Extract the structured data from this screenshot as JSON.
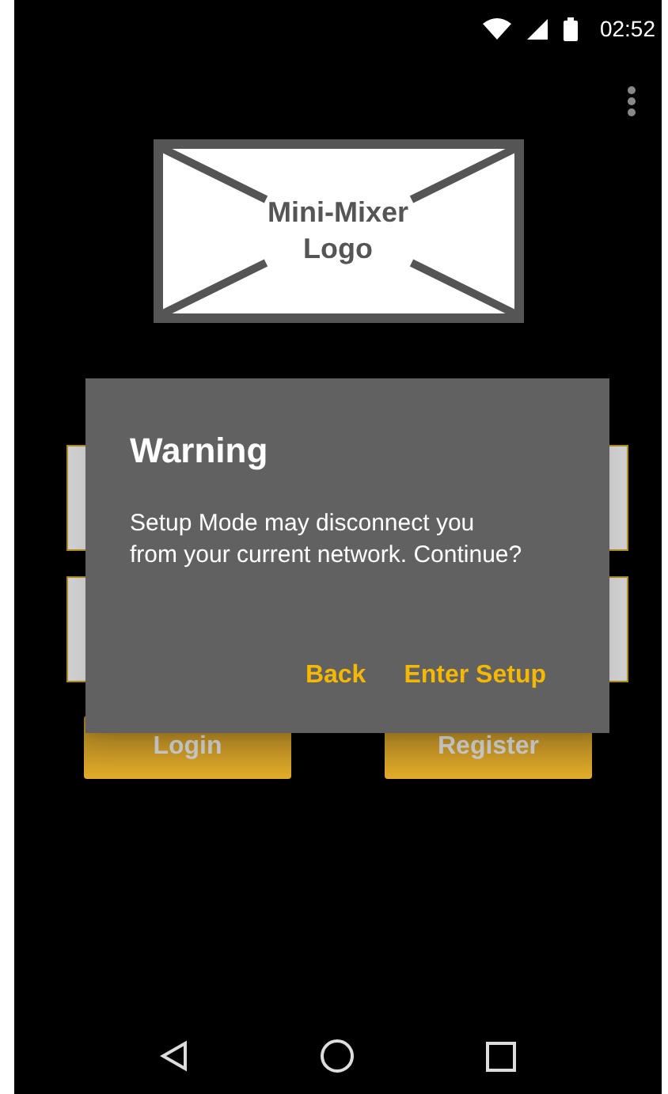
{
  "status_bar": {
    "time": "02:52"
  },
  "logo": {
    "lines": [
      "Mini-Mixer",
      "Logo"
    ]
  },
  "buttons": [
    {
      "label": "Login"
    },
    {
      "label": "Register"
    }
  ],
  "dialog": {
    "title": "Warning",
    "message": "Setup Mode may disconnect you\nfrom your current network. Continue?",
    "actions": [
      {
        "label": "Back"
      },
      {
        "label": "Enter Setup"
      }
    ]
  }
}
